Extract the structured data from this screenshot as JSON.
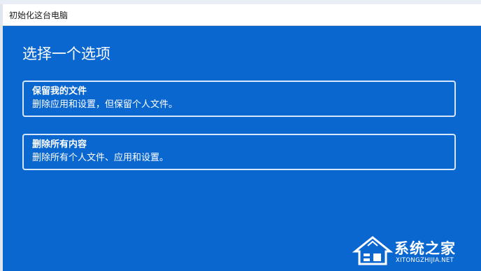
{
  "window": {
    "title": "初始化这台电脑"
  },
  "dialog": {
    "heading": "选择一个选项",
    "options": [
      {
        "title": "保留我的文件",
        "description": "删除应用和设置，但保留个人文件。"
      },
      {
        "title": "删除所有内容",
        "description": "删除所有个人文件、应用和设置。"
      }
    ]
  },
  "watermark": {
    "brand": "系统之家",
    "url": "XITONGZHIJIA.NET"
  },
  "colors": {
    "background": "#0b67d0",
    "titlebar": "#ffffff",
    "option_border": "#d6e7fb",
    "text": "#ffffff"
  }
}
